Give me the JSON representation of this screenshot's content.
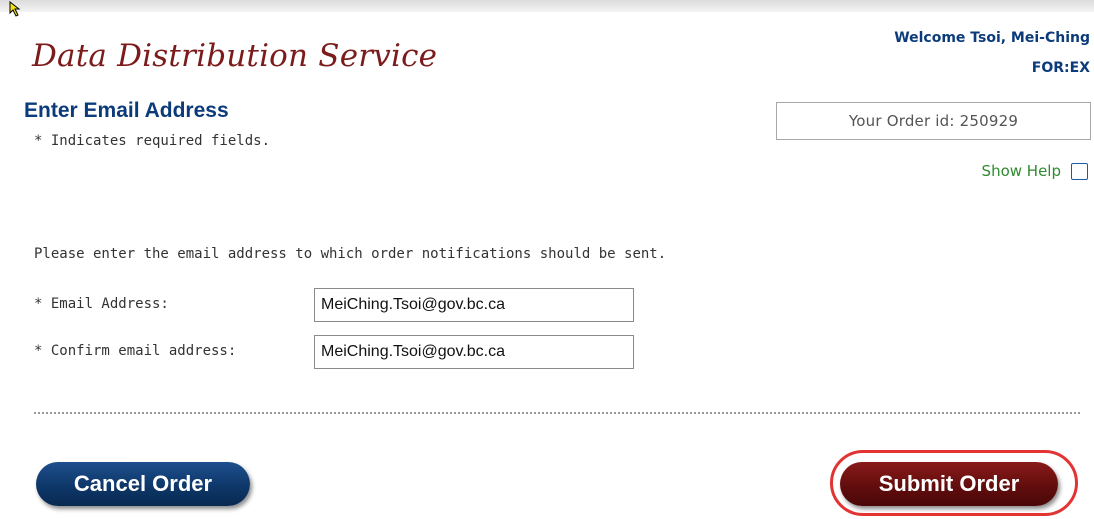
{
  "header": {
    "app_title": "Data Distribution Service",
    "welcome_text": "Welcome Tsoi, Mei-Ching",
    "org_code": "FOR:EX"
  },
  "section": {
    "title": "Enter Email Address",
    "required_note": "* Indicates required fields."
  },
  "order": {
    "id_text": "Your Order id: 250929"
  },
  "help": {
    "label": "Show Help"
  },
  "form": {
    "instruction": "Please enter the email address to which order notifications should be sent.",
    "email_label": "* Email Address:",
    "email_value": "MeiChing.Tsoi@gov.bc.ca",
    "confirm_label": "* Confirm email address:",
    "confirm_value": "MeiChing.Tsoi@gov.bc.ca"
  },
  "actions": {
    "cancel_label": "Cancel Order",
    "submit_label": "Submit Order"
  },
  "colors": {
    "title": "#7b1b1b",
    "header_text": "#0b3b7a",
    "help_text": "#2e8b2e",
    "cancel_button": "#0d3566",
    "submit_button": "#5f0c0c",
    "highlight": "#e33333"
  }
}
